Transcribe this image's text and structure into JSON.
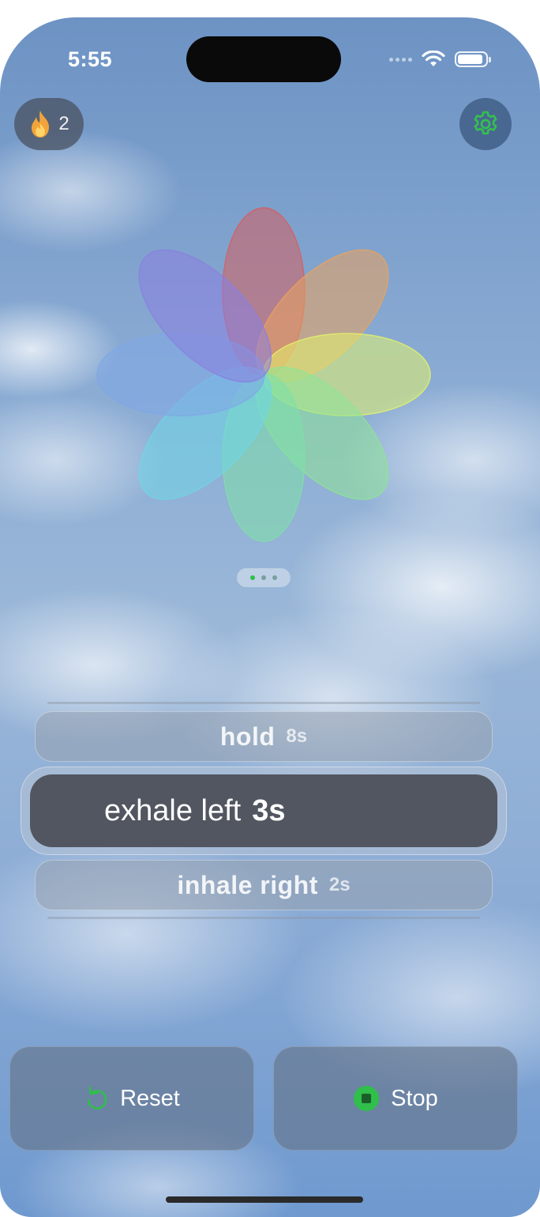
{
  "status_bar": {
    "time": "5:55",
    "battery_level": 0.9
  },
  "streak": {
    "icon": "flame-icon",
    "count": "2"
  },
  "settings": {
    "icon": "gear-icon"
  },
  "flower": {
    "petal_colors": [
      "#d65e5e",
      "#eba35c",
      "#e2f26c",
      "#8ee395",
      "#7ee0a8",
      "#6fd6e6",
      "#7fa8e6",
      "#8a7fe0"
    ]
  },
  "pager": {
    "total_pages": 3,
    "current_page": 1
  },
  "steps": {
    "previous": {
      "label": "hold",
      "duration": "8s"
    },
    "current": {
      "label": "exhale left",
      "duration": "3s"
    },
    "next": {
      "label": "inhale right",
      "duration": "2s"
    }
  },
  "buttons": {
    "reset_label": "Reset",
    "reset_icon": "reset-icon",
    "stop_label": "Stop",
    "stop_icon": "stop-icon"
  },
  "colors": {
    "accent": "#2fbf4a",
    "active_step": "#46484f"
  }
}
